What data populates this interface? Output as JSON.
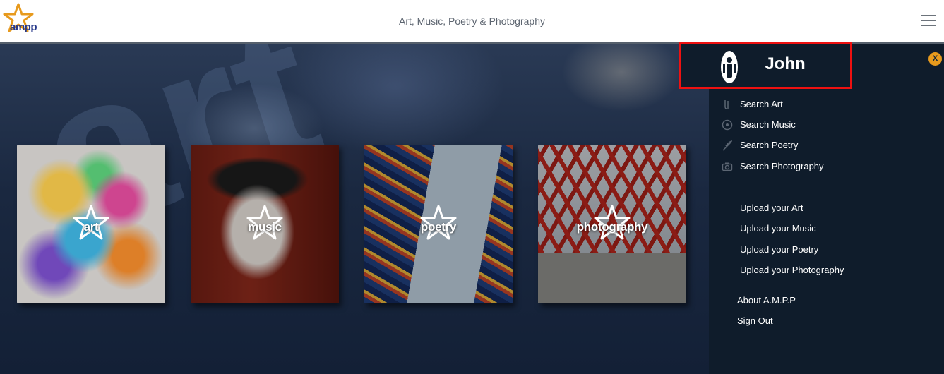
{
  "header": {
    "logo_text": "ampp",
    "tagline": "Art, Music, Poetry & Photography"
  },
  "hero": {
    "background_letters": "art"
  },
  "cards": [
    {
      "label": "art",
      "name": "art"
    },
    {
      "label": "music",
      "name": "music"
    },
    {
      "label": "poetry",
      "name": "poetry"
    },
    {
      "label": "photography",
      "name": "photography"
    }
  ],
  "sidebar": {
    "username": "John",
    "close_label": "X",
    "search_items": [
      {
        "label": "Search Art",
        "icon": "brush-icon"
      },
      {
        "label": "Search Music",
        "icon": "record-icon"
      },
      {
        "label": "Search Poetry",
        "icon": "feather-icon"
      },
      {
        "label": "Search Photography",
        "icon": "camera-icon"
      }
    ],
    "upload_items": [
      {
        "label": "Upload your Art"
      },
      {
        "label": "Upload your Music"
      },
      {
        "label": "Upload your Poetry"
      },
      {
        "label": "Upload your Photography"
      }
    ],
    "about_label": "About A.M.P.P",
    "signout_label": "Sign Out"
  },
  "colors": {
    "accent_orange": "#e79a1d",
    "brand_blue": "#27398a",
    "sidebar_bg": "#0f1c2b",
    "highlight_red": "#ee1111"
  }
}
